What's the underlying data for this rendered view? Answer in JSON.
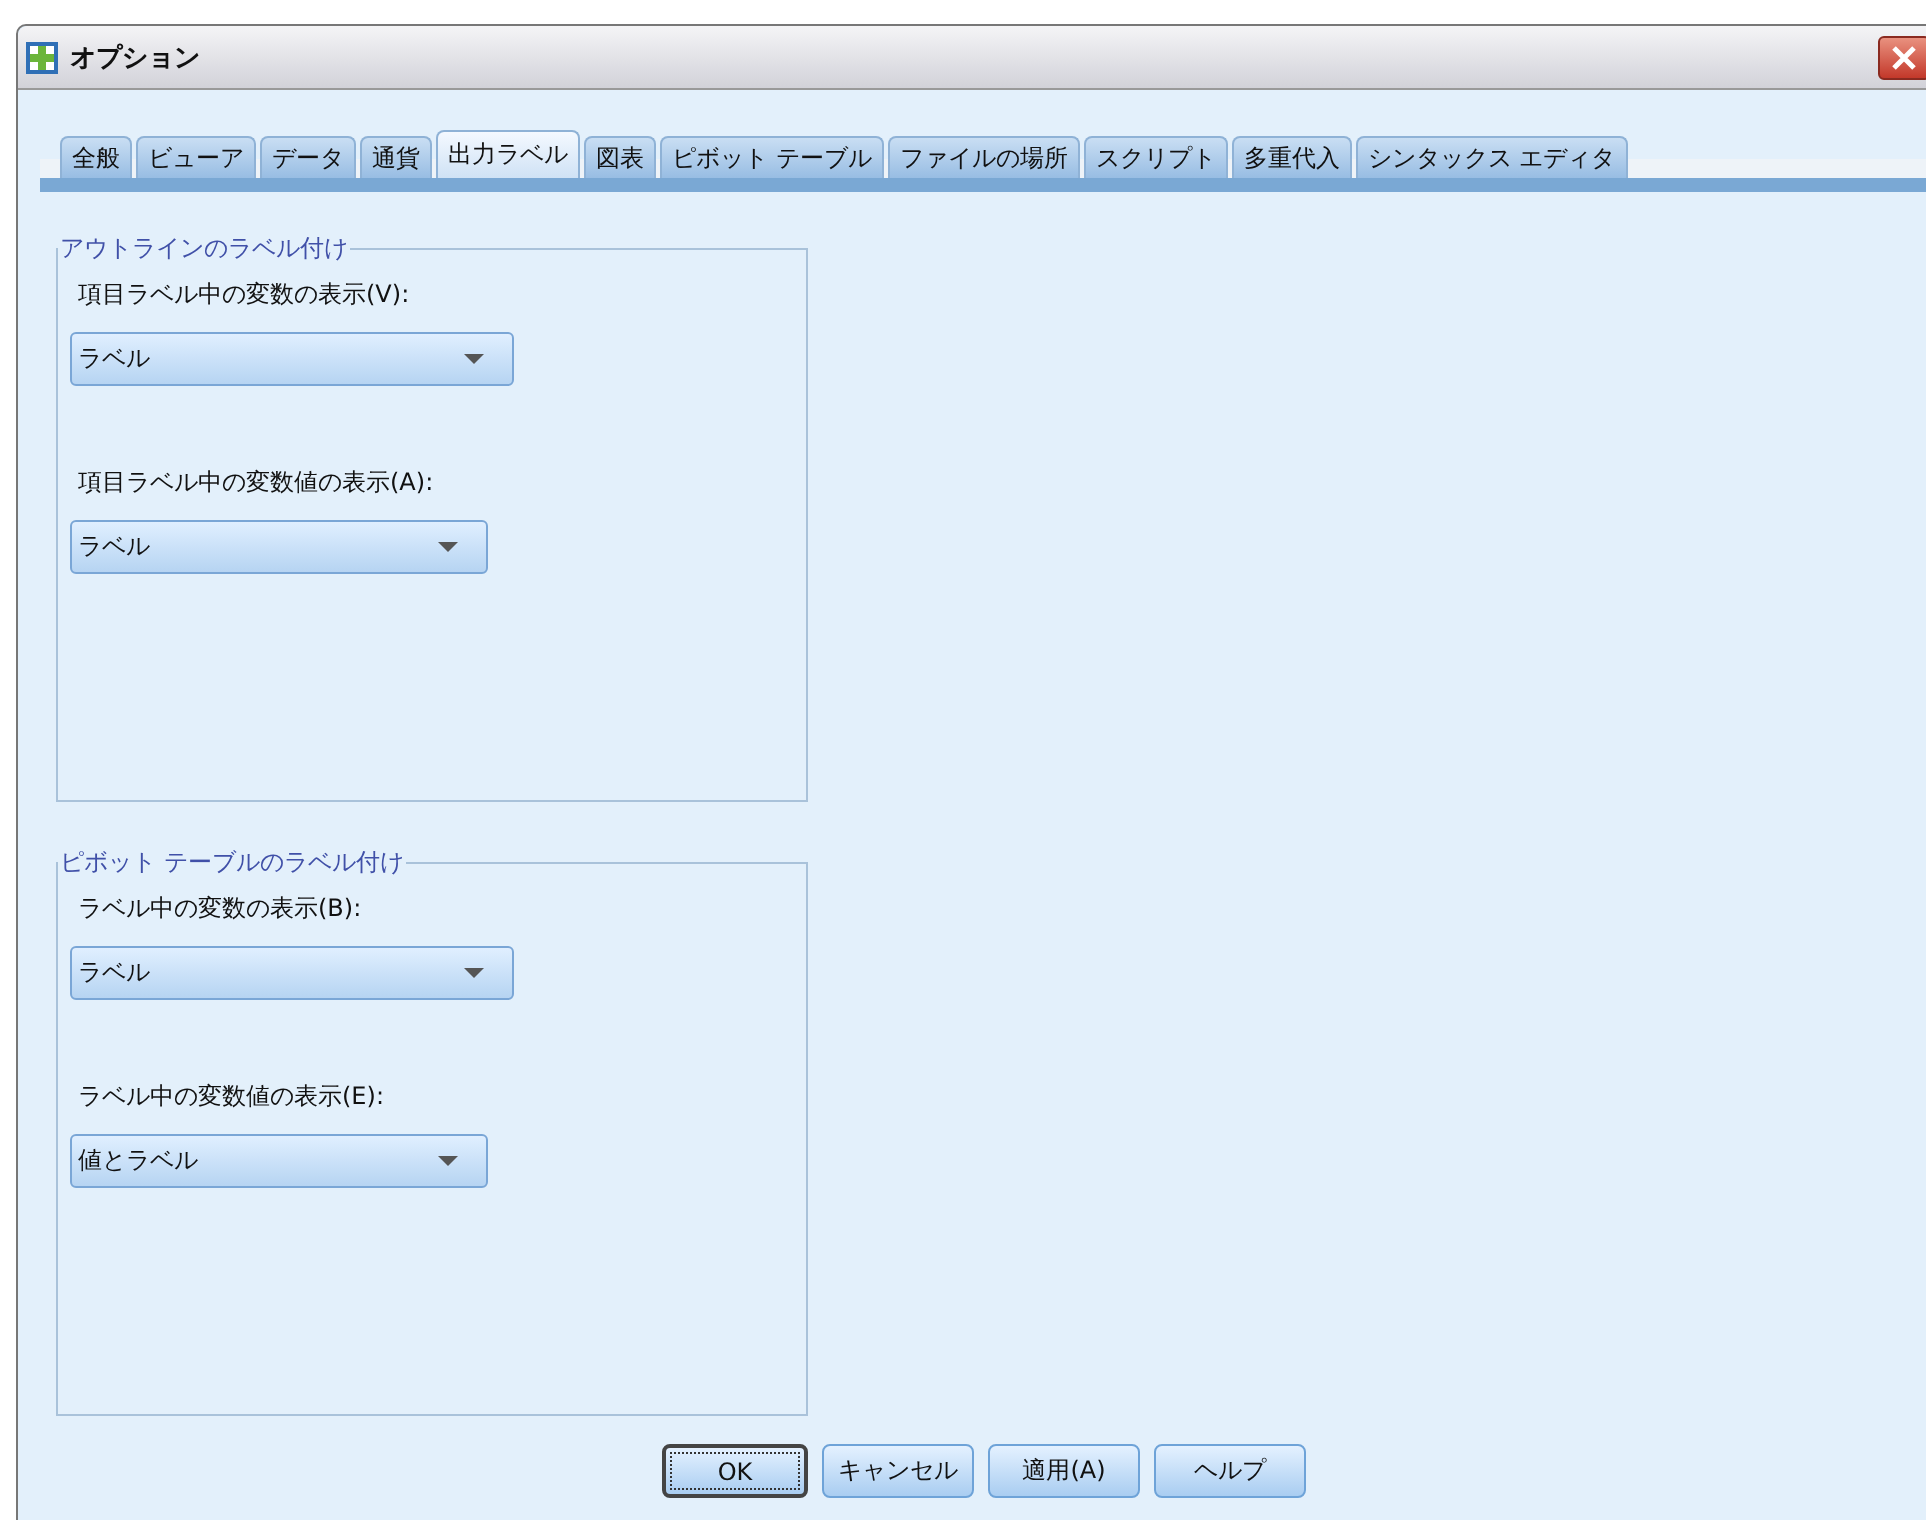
{
  "window": {
    "title": "オプション"
  },
  "tabs": [
    {
      "label": "全般",
      "selected": false
    },
    {
      "label": "ビューア",
      "selected": false
    },
    {
      "label": "データ",
      "selected": false
    },
    {
      "label": "通貨",
      "selected": false
    },
    {
      "label": "出力ラベル",
      "selected": true
    },
    {
      "label": "図表",
      "selected": false
    },
    {
      "label": "ピボット テーブル",
      "selected": false
    },
    {
      "label": "ファイルの場所",
      "selected": false
    },
    {
      "label": "スクリプト",
      "selected": false
    },
    {
      "label": "多重代入",
      "selected": false
    },
    {
      "label": "シンタックス エディタ",
      "selected": false
    }
  ],
  "groups": [
    {
      "title": "アウトラインのラベル付け",
      "fields": [
        {
          "label": "項目ラベル中の変数の表示(V):",
          "value": "ラベル",
          "wide": true
        },
        {
          "label": "項目ラベル中の変数値の表示(A):",
          "value": "ラベル",
          "wide": false
        }
      ]
    },
    {
      "title": "ピボット テーブルのラベル付け",
      "fields": [
        {
          "label": "ラベル中の変数の表示(B):",
          "value": "ラベル",
          "wide": true
        },
        {
          "label": "ラベル中の変数値の表示(E):",
          "value": "値とラベル",
          "wide": false
        }
      ]
    }
  ],
  "buttons": [
    {
      "label": "OK",
      "default": true
    },
    {
      "label": "キャンセル",
      "default": false
    },
    {
      "label": "適用(A)",
      "default": false
    },
    {
      "label": "ヘルプ",
      "default": false
    }
  ]
}
